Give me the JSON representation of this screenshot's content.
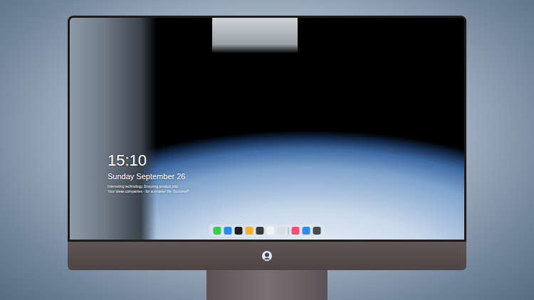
{
  "desktop": {
    "clock": {
      "time": "15:10",
      "date": "Sunday September 26"
    },
    "notes": [
      "Interesting technology. Ensuring product info.",
      "Your ideas companies - for a smarter life. Success?"
    ]
  },
  "dock": {
    "items": [
      {
        "kind": "app",
        "color": "#3ec94f"
      },
      {
        "kind": "app",
        "color": "#2a8cf0"
      },
      {
        "kind": "app",
        "color": "#1f1f1f"
      },
      {
        "kind": "app",
        "color": "#f0b429"
      },
      {
        "kind": "app",
        "color": "#3a3a3a"
      },
      {
        "kind": "app",
        "color": "#f2f2f2"
      },
      {
        "kind": "app",
        "color": "#d8dde3"
      },
      {
        "kind": "separator",
        "color": "#9aa3ad"
      },
      {
        "kind": "app",
        "color": "#f74b7a"
      },
      {
        "kind": "app",
        "color": "#2e8bf0"
      },
      {
        "kind": "app",
        "color": "#4a4a4a"
      }
    ]
  }
}
